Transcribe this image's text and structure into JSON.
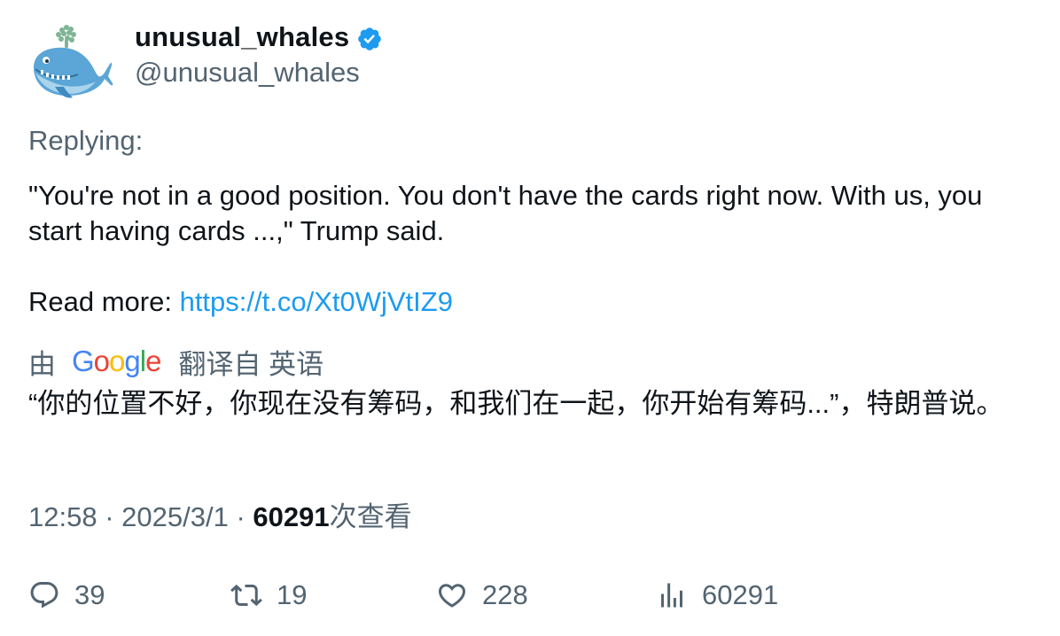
{
  "author": {
    "display_name": "unusual_whales",
    "handle": "@unusual_whales",
    "verified": true,
    "avatar_icon": "whale-avatar-icon"
  },
  "replying_label": "Replying:",
  "tweet": {
    "text": "\"You're not in a good position. You don't have the cards right now. With us, you start having cards ...,\" Trump said.",
    "read_more_label": "Read more: ",
    "link": "https://t.co/Xt0WjVtIZ9"
  },
  "translation": {
    "prefix": "由",
    "provider": "Google",
    "suffix": "翻译自 英语",
    "text": "“你的位置不好，你现在没有筹码，和我们在一起，你开始有筹码...”，特朗普说。"
  },
  "meta": {
    "time": "12:58",
    "date": "2025/3/1",
    "separator": "·",
    "views": "60291",
    "views_label": "次查看"
  },
  "actions": {
    "replies": "39",
    "retweets": "19",
    "likes": "228",
    "views": "60291"
  },
  "colors": {
    "link": "#1d9bf0",
    "secondary_text": "#536471",
    "primary_text": "#0f1419",
    "verified_badge": "#1d9bf0"
  }
}
